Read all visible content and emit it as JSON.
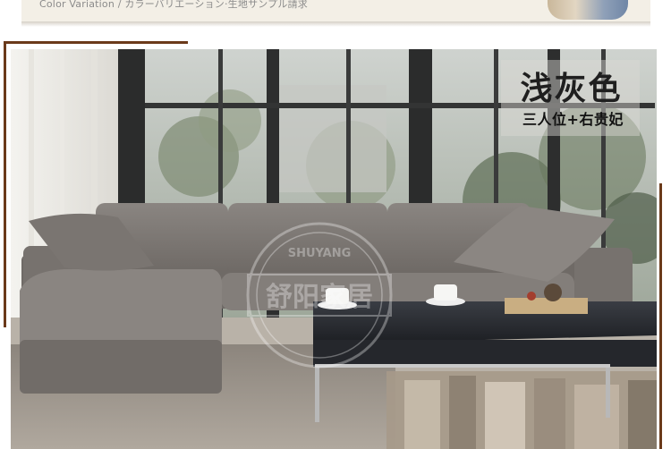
{
  "top_banner": {
    "caption": "Color Variation / カラーバリエーション·生地サンプル請求"
  },
  "product_label": {
    "color_name": "浅灰色",
    "configuration": "三人位+右贵妃"
  },
  "watermark": {
    "brand": "SHUYANG",
    "text": "舒阳家居"
  },
  "colors": {
    "frame_accent": "#6b3a1a",
    "sofa_fabric": "#7d7874",
    "table_top": "#1f2126"
  }
}
